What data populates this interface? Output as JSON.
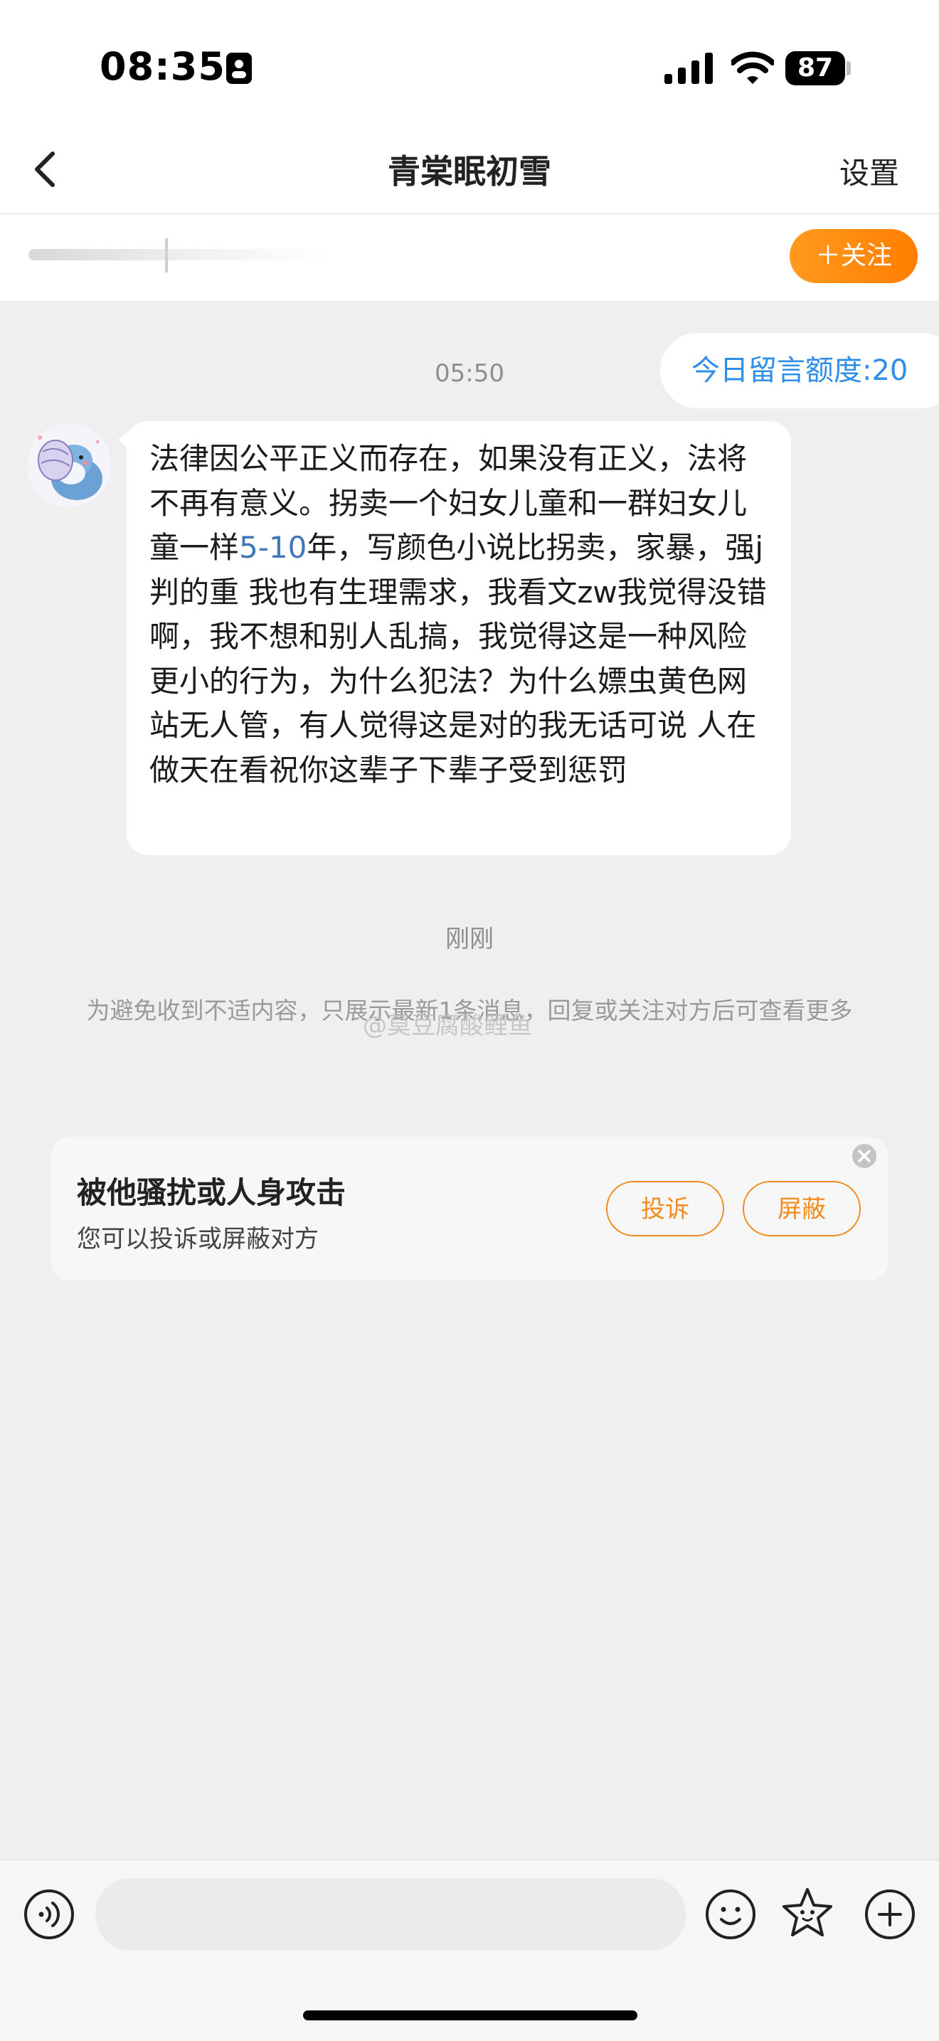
{
  "status_bar": {
    "time": "08:35",
    "battery": "87"
  },
  "nav": {
    "title": "青棠眠初雪",
    "settings": "设置"
  },
  "follow_strip": {
    "follow_button": "＋关注"
  },
  "chat": {
    "quota": "今日留言额度:20",
    "timestamp_1": "05:50",
    "message": {
      "part1": "法律因公平正义而存在，如果没有正义，法将不再有意义。拐卖一个妇女儿童和一群妇女儿童一样",
      "highlight": "5-10",
      "part2": "年，写颜色小说比拐卖，家暴，强j判的重 我也有生理需求，我看文zw我觉得没错啊，我不想和别人乱搞，我觉得这是一种风险更小的行为，为什么犯法？为什么嫖虫黄色网站无人管，有人觉得这是对的我无话可说 人在做天在看祝你这辈子下辈子受到惩罚"
    },
    "timestamp_2": "刚刚",
    "notice": "为避免收到不适内容，只展示最新1条消息，回复或关注对方后可查看更多",
    "watermark": "@莫豆腐酸鲤鱼"
  },
  "harassment_card": {
    "title": "被他骚扰或人身攻击",
    "subtitle": "您可以投诉或屏蔽对方",
    "report_button": "投诉",
    "block_button": "屏蔽"
  },
  "input_bar": {
    "placeholder": ""
  },
  "colors": {
    "accent_orange": "#ff8a0e",
    "link_blue": "#2f8ee8",
    "background": "#efefef"
  }
}
